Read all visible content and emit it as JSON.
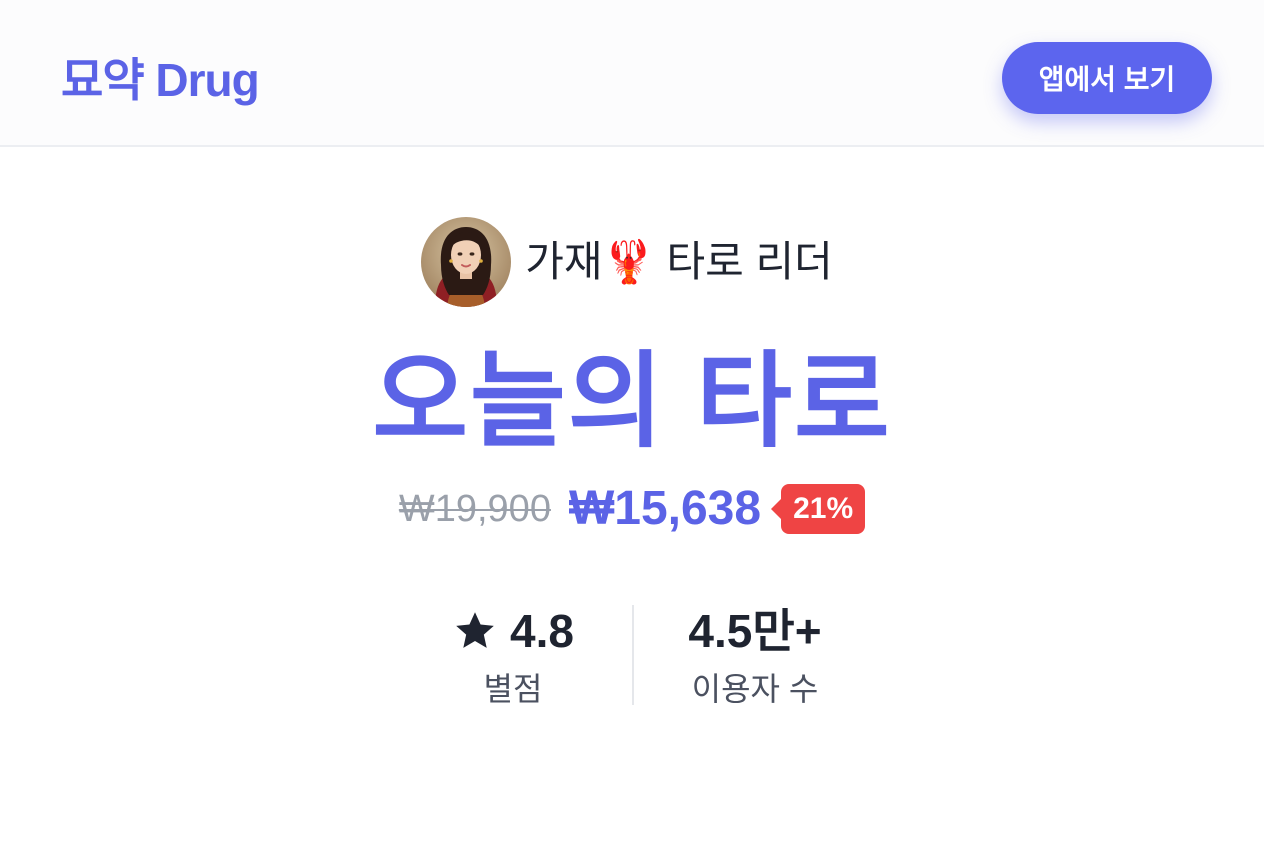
{
  "header": {
    "brand": "묘약 Drug",
    "app_button_label": "앱에서 보기"
  },
  "product": {
    "author_name": "가재🦞 타로 리더",
    "title": "오늘의 타로",
    "price_original": "₩19,900",
    "price_sale": "₩15,638",
    "discount": "21%"
  },
  "stats": {
    "rating_value": "4.8",
    "rating_label": "별점",
    "users_value": "4.5만+",
    "users_label": "이용자 수"
  },
  "icons": {
    "star": "star-icon",
    "avatar": "avatar-portrait"
  },
  "colors": {
    "brand": "#5b63e6",
    "button": "#5c65ee",
    "discount": "#ef4444",
    "text_dark": "#1f2430",
    "text_muted": "#9aa0aa"
  }
}
